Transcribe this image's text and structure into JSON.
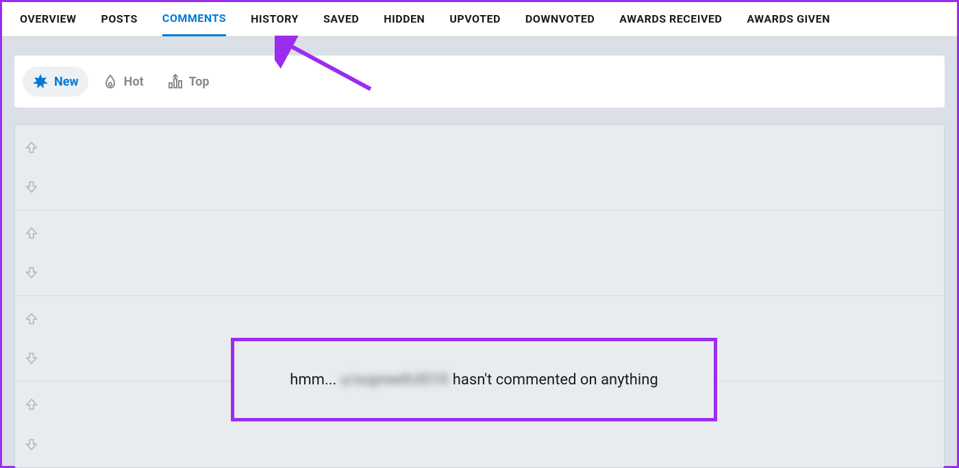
{
  "tabs": [
    {
      "label": "OVERVIEW",
      "active": false
    },
    {
      "label": "POSTS",
      "active": false
    },
    {
      "label": "COMMENTS",
      "active": true
    },
    {
      "label": "HISTORY",
      "active": false
    },
    {
      "label": "SAVED",
      "active": false
    },
    {
      "label": "HIDDEN",
      "active": false
    },
    {
      "label": "UPVOTED",
      "active": false
    },
    {
      "label": "DOWNVOTED",
      "active": false
    },
    {
      "label": "AWARDS RECEIVED",
      "active": false
    },
    {
      "label": "AWARDS GIVEN",
      "active": false
    }
  ],
  "sort": {
    "new": "New",
    "hot": "Hot",
    "top": "Top"
  },
  "empty_state": {
    "prefix": "hmm... ",
    "username_blurred": "u/supreeth3010",
    "suffix": " hasn't commented on anything"
  }
}
